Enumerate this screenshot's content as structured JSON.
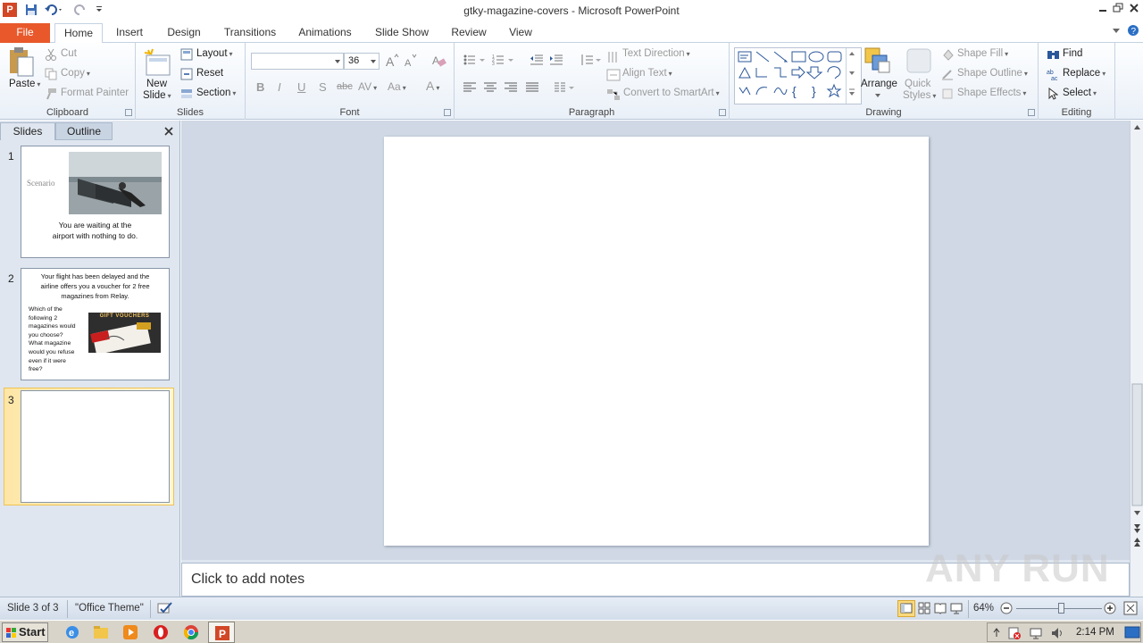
{
  "window": {
    "title": "gtky-magazine-covers  -  Microsoft PowerPoint",
    "app_letter": "P"
  },
  "tabs": [
    "File",
    "Home",
    "Insert",
    "Design",
    "Transitions",
    "Animations",
    "Slide Show",
    "Review",
    "View"
  ],
  "ribbon": {
    "clipboard": {
      "paste": "Paste",
      "cut": "Cut",
      "copy": "Copy",
      "format_painter": "Format Painter",
      "label": "Clipboard"
    },
    "slides": {
      "new_slide": "New",
      "new_slide2": "Slide",
      "layout": "Layout",
      "reset": "Reset",
      "section": "Section",
      "label": "Slides"
    },
    "font": {
      "size": "36",
      "label": "Font",
      "bold": "B",
      "italic": "I",
      "underline": "U",
      "shadow": "S",
      "strike": "abc",
      "spacing": "AV",
      "case": "Aa",
      "color": "A"
    },
    "paragraph": {
      "text_direction": "Text Direction",
      "align_text": "Align Text",
      "smartart": "Convert to SmartArt",
      "label": "Paragraph"
    },
    "drawing": {
      "arrange": "Arrange",
      "quick_styles": "Quick",
      "quick_styles2": "Styles",
      "shape_fill": "Shape Fill",
      "shape_outline": "Shape Outline",
      "shape_effects": "Shape Effects",
      "label": "Drawing"
    },
    "editing": {
      "find": "Find",
      "replace": "Replace",
      "select": "Select",
      "label": "Editing"
    }
  },
  "panel": {
    "tab_slides": "Slides",
    "tab_outline": "Outline",
    "thumbs": [
      {
        "num": "1",
        "title": "Scenario",
        "caption1": "You are waiting at the",
        "caption2": "airport with nothing to do."
      },
      {
        "num": "2",
        "heading1": "Your flight has been delayed and the",
        "heading2": "airline offers you a voucher for 2 free",
        "heading3": "magazines from Relay.",
        "q1": "Which of the",
        "q2": "following 2",
        "q3": "magazines would",
        "q4": "you choose?",
        "q5": "What magazine",
        "q6": "would you refuse",
        "q7": "even if it were",
        "q8": "free?",
        "voucher_text": "GIFT VOUCHERS"
      },
      {
        "num": "3"
      }
    ]
  },
  "notes": {
    "placeholder": "Click to add notes"
  },
  "status": {
    "slide": "Slide 3 of 3",
    "theme": "\"Office Theme\"",
    "zoom": "64%",
    "zoom_fraction": 0.52
  },
  "taskbar": {
    "start": "Start",
    "clock": "2:14 PM"
  },
  "watermark": "ANY RUN",
  "colors": {
    "file_tab": "#e8582b",
    "accent": "#2b579a",
    "selected_thumb": "#fbd97c"
  }
}
